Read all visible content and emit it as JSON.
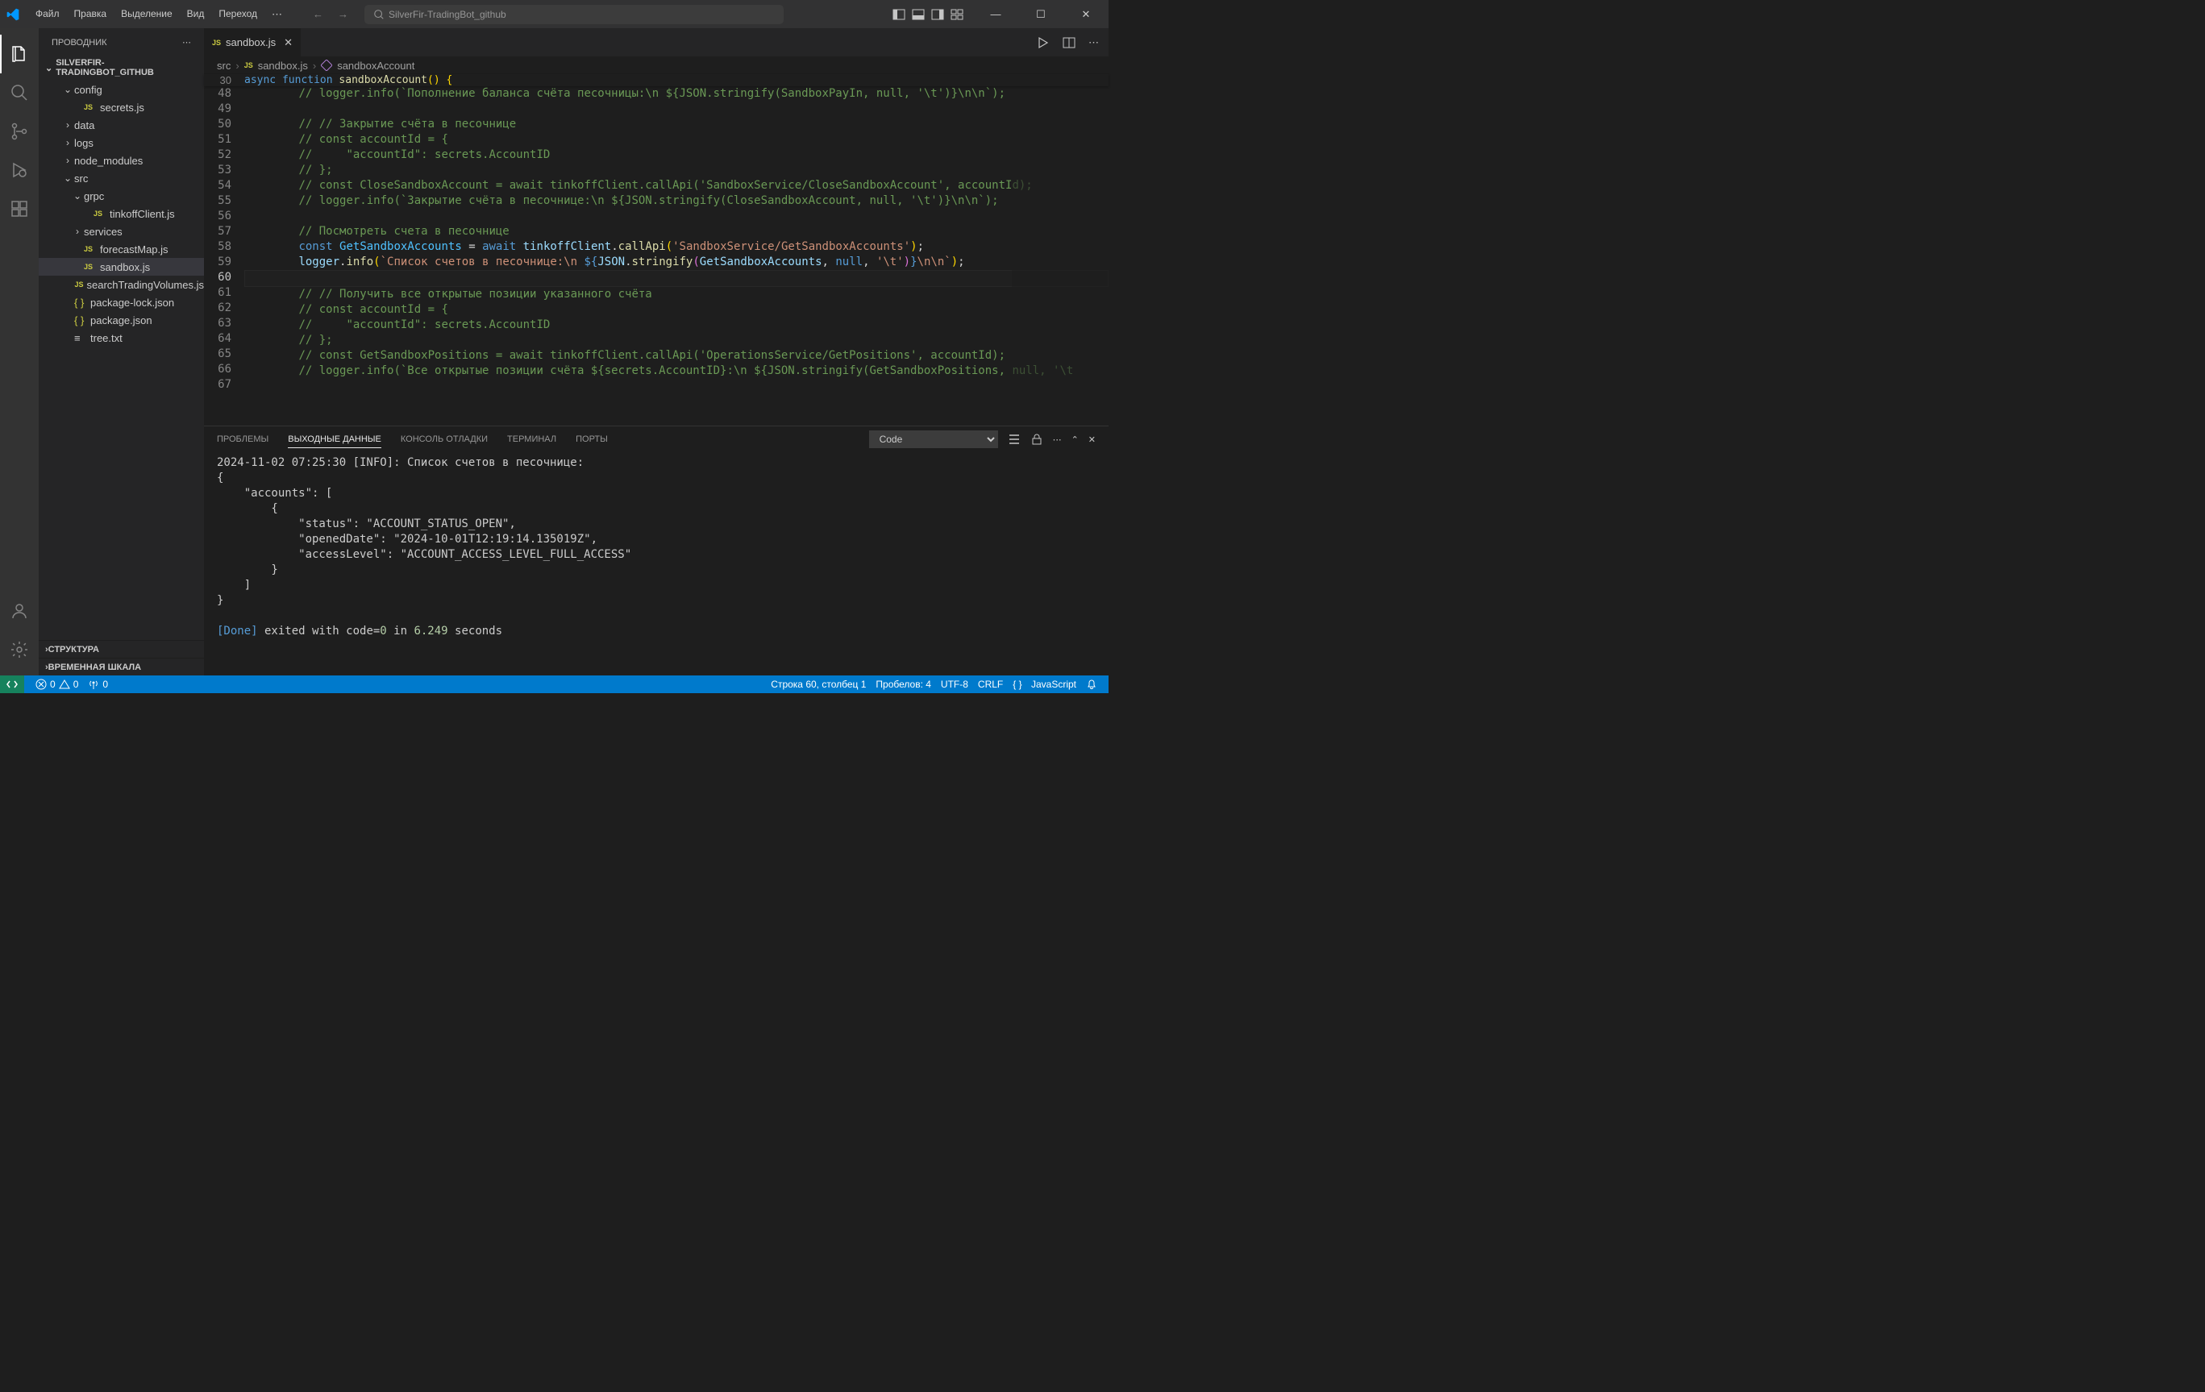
{
  "menu": {
    "items": [
      "Файл",
      "Правка",
      "Выделение",
      "Вид",
      "Переход"
    ]
  },
  "search": {
    "placeholder": "SilverFir-TradingBot_github"
  },
  "sidebar": {
    "title": "ПРОВОДНИК",
    "project": "SILVERFIR-TRADINGBOT_GITHUB",
    "tree": [
      {
        "label": "config",
        "type": "folder",
        "open": true,
        "indent": 1
      },
      {
        "label": "secrets.js",
        "type": "js",
        "indent": 2
      },
      {
        "label": "data",
        "type": "folder",
        "open": false,
        "indent": 1
      },
      {
        "label": "logs",
        "type": "folder",
        "open": false,
        "indent": 1
      },
      {
        "label": "node_modules",
        "type": "folder",
        "open": false,
        "indent": 1
      },
      {
        "label": "src",
        "type": "folder",
        "open": true,
        "indent": 1
      },
      {
        "label": "grpc",
        "type": "folder",
        "open": true,
        "indent": 2
      },
      {
        "label": "tinkoffClient.js",
        "type": "js",
        "indent": 3
      },
      {
        "label": "services",
        "type": "folder",
        "open": false,
        "indent": 2
      },
      {
        "label": "forecastMap.js",
        "type": "js",
        "indent": 2
      },
      {
        "label": "sandbox.js",
        "type": "js",
        "indent": 2,
        "selected": true
      },
      {
        "label": "searchTradingVolumes.js",
        "type": "js",
        "indent": 2
      },
      {
        "label": "package-lock.json",
        "type": "json",
        "indent": 1
      },
      {
        "label": "package.json",
        "type": "json",
        "indent": 1
      },
      {
        "label": "tree.txt",
        "type": "txt",
        "indent": 1
      }
    ],
    "footer": [
      "СТРУКТУРА",
      "ВРЕМЕННАЯ ШКАЛА"
    ]
  },
  "tabs": [
    {
      "label": "sandbox.js",
      "icon": "js",
      "active": true
    }
  ],
  "breadcrumb": {
    "parts": [
      "src",
      "sandbox.js",
      "sandboxAccount"
    ]
  },
  "editor": {
    "sticky": {
      "num": "30",
      "text_parts": [
        "async ",
        "function ",
        "sandboxAccount",
        "(",
        ") ",
        "{"
      ]
    },
    "lines": [
      {
        "num": "48",
        "html": "        <span class='cm'>// logger.info(`Пополнение баланса счёта песочницы:\\n ${JSON.stringify(SandboxPayIn, null, '\\t')}\\n\\n`);</span>"
      },
      {
        "num": "49",
        "html": ""
      },
      {
        "num": "50",
        "html": "        <span class='cm'>// // Закрытие счёта в песочнице</span>"
      },
      {
        "num": "51",
        "html": "        <span class='cm'>// const accountId = {</span>"
      },
      {
        "num": "52",
        "html": "        <span class='cm'>//     \"accountId\": secrets.AccountID</span>"
      },
      {
        "num": "53",
        "html": "        <span class='cm'>// };</span>"
      },
      {
        "num": "54",
        "html": "        <span class='cm'>// const CloseSandboxAccount = await tinkoffClient.callApi('SandboxService/CloseSandboxAccount', accountId);</span>"
      },
      {
        "num": "55",
        "html": "        <span class='cm'>// logger.info(`Закрытие счёта в песочнице:\\n ${JSON.stringify(CloseSandboxAccount, null, '\\t')}\\n\\n`);</span>"
      },
      {
        "num": "56",
        "html": ""
      },
      {
        "num": "57",
        "html": "        <span class='cm'>// Посмотреть счета в песочнице</span>"
      },
      {
        "num": "58",
        "html": "        <span class='kw'>const</span> <span class='cn'>GetSandboxAccounts</span> <span class='op'>=</span> <span class='kw'>await</span> <span class='nm'>tinkoffClient</span>.<span class='fn'>callApi</span><span class='pn'>(</span><span class='st'>'SandboxService/GetSandboxAccounts'</span><span class='pn'>)</span>;"
      },
      {
        "num": "59",
        "html": "        <span class='nm'>logger</span>.<span class='fn'>info</span><span class='pn'>(</span><span class='st'>`Список счетов в песочнице:\\n </span><span class='tl'>${</span><span class='nm'>JSON</span>.<span class='fn'>stringify</span><span class='pn2'>(</span><span class='nm'>GetSandboxAccounts</span>, <span class='kw'>null</span>, <span class='st'>'\\t'</span><span class='pn2'>)</span><span class='tl'>}</span><span class='st'>\\n\\n`</span><span class='pn'>)</span>;"
      },
      {
        "num": "60",
        "html": "",
        "current": true
      },
      {
        "num": "61",
        "html": "        <span class='cm'>// // Получить все открытые позиции указанного счёта</span>"
      },
      {
        "num": "62",
        "html": "        <span class='cm'>// const accountId = {</span>"
      },
      {
        "num": "63",
        "html": "        <span class='cm'>//     \"accountId\": secrets.AccountID</span>"
      },
      {
        "num": "64",
        "html": "        <span class='cm'>// };</span>"
      },
      {
        "num": "65",
        "html": "        <span class='cm'>// const GetSandboxPositions = await tinkoffClient.callApi('OperationsService/GetPositions', accountId);</span>"
      },
      {
        "num": "66",
        "html": "        <span class='cm'>// logger.info(`Все открытые позиции счёта ${secrets.AccountID}:\\n ${JSON.stringify(GetSandboxPositions, null, '\\t</span>"
      },
      {
        "num": "67",
        "html": ""
      }
    ]
  },
  "panel": {
    "tabs": [
      "ПРОБЛЕМЫ",
      "ВЫХОДНЫЕ ДАННЫЕ",
      "КОНСОЛЬ ОТЛАДКИ",
      "ТЕРМИНАЛ",
      "ПОРТЫ"
    ],
    "active_tab": 1,
    "select": "Code",
    "output": "2024-11-02 07:25:30 [INFO]: Список счетов в песочнице:\n{\n    \"accounts\": [\n        {\n            \"status\": \"ACCOUNT_STATUS_OPEN\",\n            \"openedDate\": \"2024-10-01T12:19:14.135019Z\",\n            \"accessLevel\": \"ACCOUNT_ACCESS_LEVEL_FULL_ACCESS\"\n        }\n    ]\n}\n\n",
    "done_line_parts": [
      "[Done]",
      " exited with code=",
      "0",
      " in ",
      "6.249",
      " seconds"
    ]
  },
  "status": {
    "errors": "0",
    "warnings": "0",
    "port": "0",
    "cursor": "Строка 60, столбец 1",
    "spaces": "Пробелов: 4",
    "encoding": "UTF-8",
    "eol": "CRLF",
    "lang_icon": "{ }",
    "lang": "JavaScript"
  }
}
